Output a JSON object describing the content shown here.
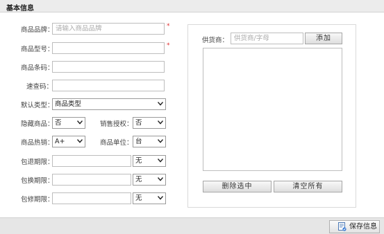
{
  "header": {
    "title": "基本信息"
  },
  "form": {
    "product_name": {
      "label": "商品品牌：",
      "placeholder": "请输入商品品牌",
      "value": "",
      "required_mark": "*"
    },
    "product_model": {
      "label": "商品型号：",
      "value": "",
      "required_mark": "*"
    },
    "product_barcode": {
      "label": "商品条码：",
      "value": ""
    },
    "quick_code": {
      "label": "速查码：",
      "value": ""
    },
    "default_type": {
      "label": "默认类型：",
      "selected": "商品类型"
    },
    "hide_product": {
      "label": "隐藏商品：",
      "selected": "否"
    },
    "sales_auth": {
      "label": "销售授权：",
      "selected": "否"
    },
    "hot_sale": {
      "label": "商品热销：",
      "selected": "A+"
    },
    "unit": {
      "label": "商品单位：",
      "selected": "台"
    },
    "return_period": {
      "label": "包退期限：",
      "value": "",
      "selected": "无"
    },
    "exchange_period": {
      "label": "包换期限：",
      "value": "",
      "selected": "无"
    },
    "repair_period": {
      "label": "包修期限：",
      "value": "",
      "selected": "无"
    }
  },
  "supplier": {
    "label": "供货商：",
    "placeholder": "供货商/字母",
    "add_label": "添加",
    "delete_selected_label": "删除选中",
    "clear_all_label": "清空所有"
  },
  "footer": {
    "save_label": "保存信息"
  }
}
